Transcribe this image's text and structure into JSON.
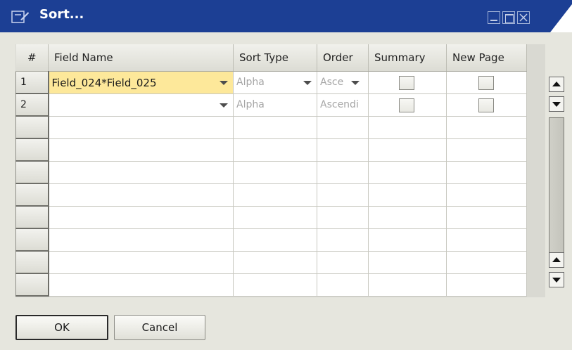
{
  "window": {
    "title": "Sort...",
    "controls": [
      "minimize-icon",
      "maximize-icon",
      "close-icon"
    ],
    "colors": {
      "titlebar": "#1c3f94",
      "active_cell": "#fde89a",
      "background": "#e6e6de"
    }
  },
  "grid": {
    "columns": [
      "#",
      "Field Name",
      "Sort Type",
      "Order",
      "Summary",
      "New Page"
    ],
    "rows": [
      {
        "num": "1",
        "field": "Field_024*Field_025",
        "sort_type": "Alpha",
        "order": "Asce",
        "summary": false,
        "new_page": false
      },
      {
        "num": "2",
        "field": "",
        "sort_type": "Alpha",
        "order": "Ascendi",
        "summary": false,
        "new_page": false
      },
      {
        "num": "",
        "field": "",
        "sort_type": "",
        "order": ""
      },
      {
        "num": "",
        "field": "",
        "sort_type": "",
        "order": ""
      },
      {
        "num": "",
        "field": "",
        "sort_type": "",
        "order": ""
      },
      {
        "num": "",
        "field": "",
        "sort_type": "",
        "order": ""
      },
      {
        "num": "",
        "field": "",
        "sort_type": "",
        "order": ""
      },
      {
        "num": "",
        "field": "",
        "sort_type": "",
        "order": ""
      },
      {
        "num": "",
        "field": "",
        "sort_type": "",
        "order": ""
      },
      {
        "num": "",
        "field": "",
        "sort_type": "",
        "order": ""
      }
    ]
  },
  "buttons": {
    "ok": "OK",
    "cancel": "Cancel"
  }
}
